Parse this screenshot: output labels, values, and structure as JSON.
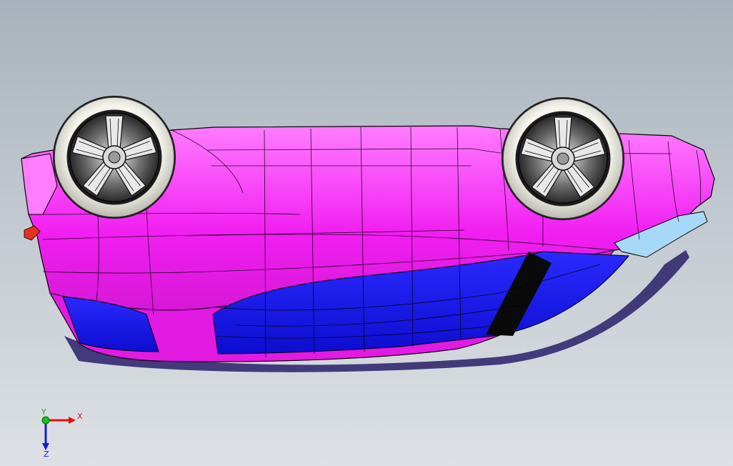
{
  "scene": {
    "colors": {
      "background_top": "#a9b2bc",
      "background_bottom": "#dde1e5",
      "body": "#f21ff2",
      "body_highlight": "#ff8cff",
      "body_shadow": "#b40fb4",
      "side_panel": "#1a1af0",
      "glass": "#a8d8f8",
      "tire": "#e8e8dc",
      "rim": "#4a4a4a",
      "edge_lines": "#000000"
    }
  },
  "triad": {
    "x_label": "X",
    "y_label": "Y",
    "z_label": "Z",
    "x_icon": "x-axis-arrow-icon",
    "y_icon": "y-axis-dot-icon",
    "z_icon": "z-axis-arrow-icon"
  }
}
